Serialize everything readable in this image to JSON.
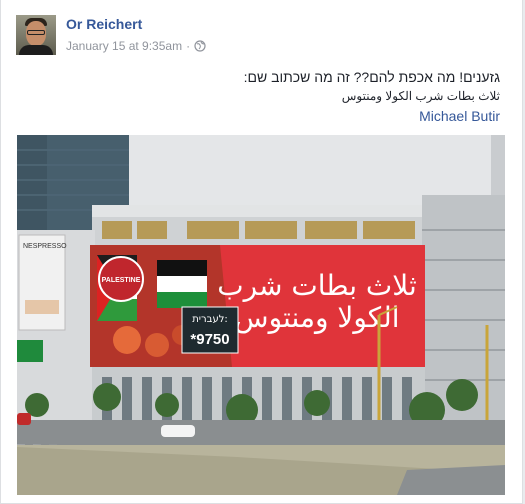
{
  "post": {
    "author": "Or Reichert",
    "timestamp": "January 15 at 9:35am",
    "separator": "·",
    "privacy_icon": "globe-icon",
    "text_line1": "גזענים! מה אכפת להם?? זה מה שכתוב שם:",
    "text_line2": "ثلاث بطات شرب الكولا ومنتوس",
    "mention": "Michael Butir"
  },
  "photo": {
    "billboard_arabic_line1": "ثلاث بطات شرب",
    "billboard_arabic_line2": "الكولا ومنتوس",
    "billboard_hebrew_label": "לעברית:",
    "billboard_number": "*9750",
    "badge_text": "PALESTINE",
    "nespresso_text": "NESPRESSO"
  },
  "colors": {
    "link": "#365899",
    "meta": "#90949c",
    "billboard_red": "#e0343a",
    "billboard_green": "#2f9a3c"
  }
}
